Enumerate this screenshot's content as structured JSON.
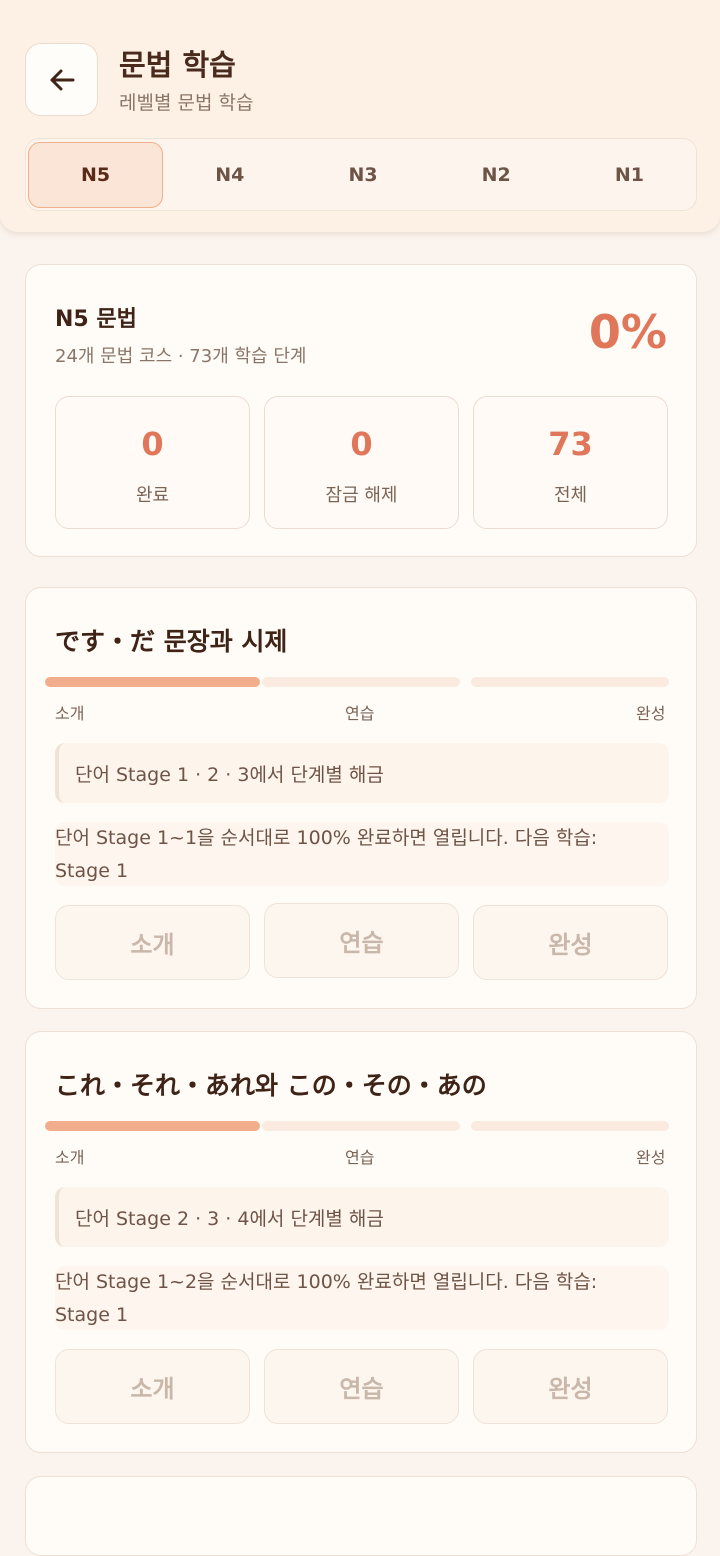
{
  "header": {
    "title": "문법 학습",
    "subtitle": "레벨별 문법 학습",
    "back_icon": "arrow-left-icon"
  },
  "levels": {
    "tabs": [
      "N5",
      "N4",
      "N3",
      "N2",
      "N1"
    ],
    "active": "N5"
  },
  "summary": {
    "title": "N5 문법",
    "subtitle": "24개 문법 코스 · 73개 학습 단계",
    "percent": "0%",
    "stats": [
      {
        "value": "0",
        "label": "완료"
      },
      {
        "value": "0",
        "label": "잠금 해제"
      },
      {
        "value": "73",
        "label": "전체"
      }
    ]
  },
  "grammar_items": [
    {
      "title": "です・だ 문장과 시제",
      "stages": [
        "소개",
        "연습",
        "완성"
      ],
      "unlock_note": "단어 Stage 1 · 2 · 3에서 단계별 해금",
      "lock_message_line1": "단어 Stage 1~1을 순서대로 100% 완료하면 열립니다. 다음 학습:",
      "lock_message_line2": "Stage 1",
      "buttons": [
        "소개",
        "연습",
        "완성"
      ]
    },
    {
      "title": "これ・それ・あれ와 この・その・あの",
      "stages": [
        "소개",
        "연습",
        "완성"
      ],
      "unlock_note": "단어 Stage 2 · 3 · 4에서 단계별 해금",
      "lock_message_line1": "단어 Stage 1~2을 순서대로 100% 완료하면 열립니다. 다음 학습:",
      "lock_message_line2": "Stage 1",
      "buttons": [
        "소개",
        "연습",
        "완성"
      ]
    }
  ],
  "colors": {
    "accent": "#e0765a",
    "progress_fill": "#f2ae8c",
    "header_bg": "#fdf1e6",
    "page_bg": "#fbf4ee"
  }
}
